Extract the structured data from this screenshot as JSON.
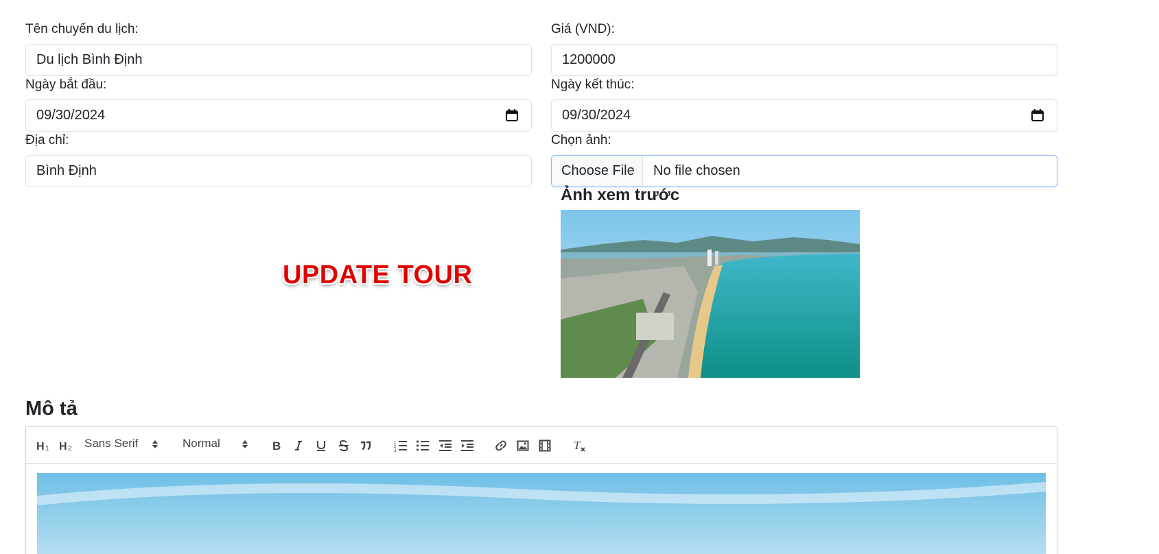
{
  "form": {
    "tour_name": {
      "label": "Tên chuyến du lịch:",
      "value": "Du lịch Bình Định"
    },
    "price": {
      "label": "Giá (VND):",
      "value": "1200000"
    },
    "start_date": {
      "label": "Ngày bắt đầu:",
      "value": "09/30/2024"
    },
    "end_date": {
      "label": "Ngày kết thúc:",
      "value": "09/30/2024"
    },
    "address": {
      "label": "Địa chỉ:",
      "value": "Bình Định"
    },
    "image": {
      "label": "Chọn ảnh:",
      "button_label": "Choose File",
      "status": "No file chosen"
    }
  },
  "preview": {
    "title": "Ảnh xem trước",
    "image_icon": "coastal-city-photo"
  },
  "page_title": "UPDATE TOUR",
  "description": {
    "title": "Mô tả",
    "toolbar": {
      "font_select": "Sans Serif",
      "size_select": "Normal",
      "icons": [
        "h1-icon",
        "h2-icon",
        "bold-icon",
        "italic-icon",
        "underline-icon",
        "strike-icon",
        "blockquote-icon",
        "ordered-list-icon",
        "bullet-list-icon",
        "outdent-icon",
        "indent-icon",
        "link-icon",
        "image-icon",
        "video-icon",
        "clear-format-icon"
      ]
    }
  },
  "colors": {
    "title_red": "#e00000",
    "focus_border": "#86b7fe",
    "sea": "#1a9fa8",
    "sky": "#8fd0ec"
  }
}
